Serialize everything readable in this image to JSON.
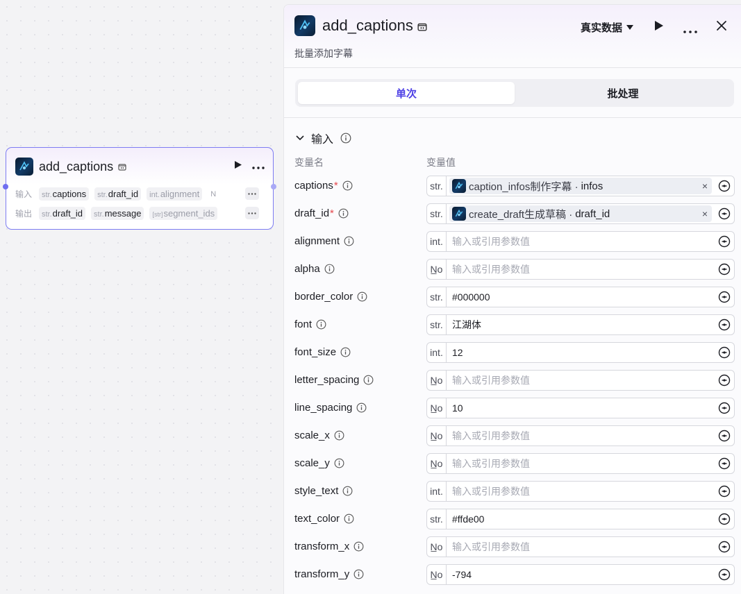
{
  "node": {
    "title": "add_captions",
    "input_label": "输入",
    "output_label": "输出",
    "inputs": [
      {
        "type": "str.",
        "name": "captions"
      },
      {
        "type": "str.",
        "name": "draft_id"
      },
      {
        "type": "int.",
        "name": "alignment"
      },
      {
        "type": "N",
        "name": ""
      }
    ],
    "outputs": [
      {
        "type": "str.",
        "name": "draft_id"
      },
      {
        "type": "str.",
        "name": "message"
      },
      {
        "type": "[str]",
        "name": "segment_ids"
      }
    ]
  },
  "panel": {
    "title": "add_captions",
    "subtitle": "批量添加字幕",
    "mode_selector": "真实数据",
    "tabs": [
      "单次",
      "批处理"
    ],
    "section_title": "输入",
    "col_name": "变量名",
    "col_value": "变量值",
    "placeholder": "输入或引用参数值",
    "params": [
      {
        "name": "captions",
        "required": true,
        "type": "str.",
        "ref_node": "caption_infos制作字幕 ·",
        "ref_field": "infos"
      },
      {
        "name": "draft_id",
        "required": true,
        "type": "str.",
        "ref_node": "create_draft生成草稿 ·",
        "ref_field": "draft_id"
      },
      {
        "name": "alignment",
        "type": "int.",
        "value": ""
      },
      {
        "name": "alpha",
        "type": "N̲o",
        "value": ""
      },
      {
        "name": "border_color",
        "type": "str.",
        "value": "#000000"
      },
      {
        "name": "font",
        "type": "str.",
        "value": "江湖体"
      },
      {
        "name": "font_size",
        "type": "int.",
        "value": "12"
      },
      {
        "name": "letter_spacing",
        "type": "N̲o",
        "value": ""
      },
      {
        "name": "line_spacing",
        "type": "N̲o",
        "value": "10"
      },
      {
        "name": "scale_x",
        "type": "N̲o",
        "value": ""
      },
      {
        "name": "scale_y",
        "type": "N̲o",
        "value": ""
      },
      {
        "name": "style_text",
        "type": "int.",
        "value": ""
      },
      {
        "name": "text_color",
        "type": "str.",
        "value": "#ffde00"
      },
      {
        "name": "transform_x",
        "type": "N̲o",
        "value": ""
      },
      {
        "name": "transform_y",
        "type": "N̲o",
        "value": "-794"
      }
    ]
  },
  "colors": {
    "accent": "#4e40e5",
    "node_border": "#7d7cf2",
    "required": "#e5484d"
  }
}
